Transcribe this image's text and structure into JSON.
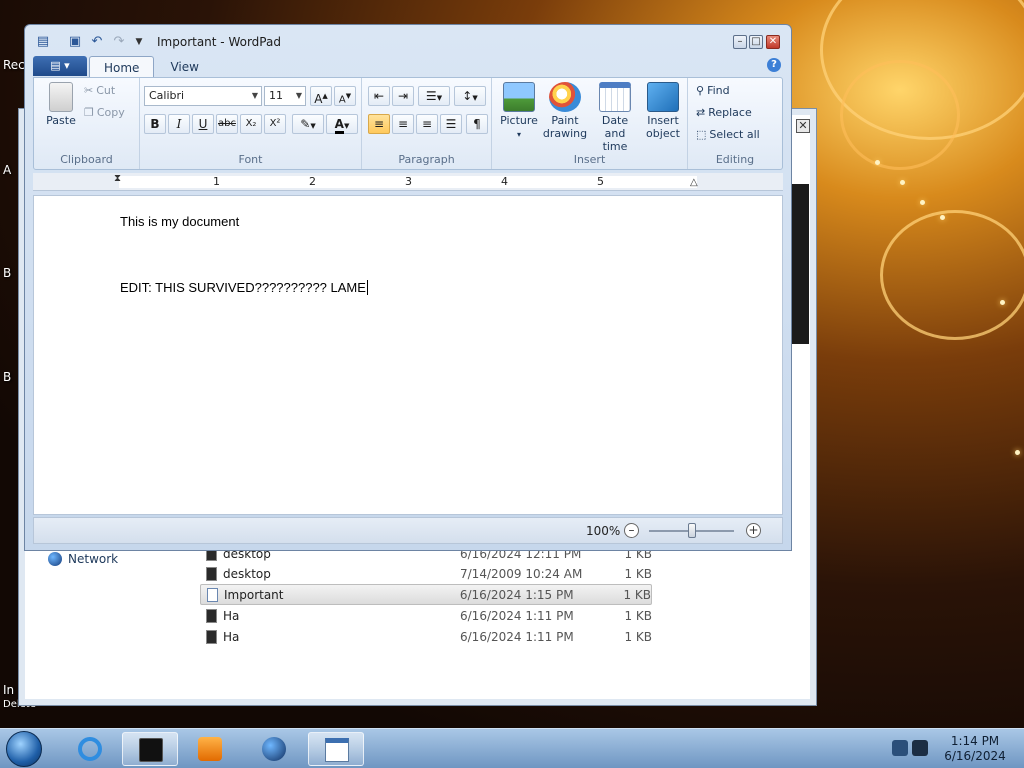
{
  "desktop": {
    "labels": [
      "Rec",
      "A",
      "B",
      "B",
      "In",
      "Delete"
    ]
  },
  "explorer": {
    "nav_network_label": "Network",
    "files": [
      {
        "name": "desktop",
        "date": "6/16/2024 12:11 PM",
        "size": "1 KB",
        "icon": "config-file-icon",
        "selected": false
      },
      {
        "name": "desktop",
        "date": "7/14/2009 10:24 AM",
        "size": "1 KB",
        "icon": "config-file-icon",
        "selected": false
      },
      {
        "name": "Important",
        "date": "6/16/2024 1:15 PM",
        "size": "1 KB",
        "icon": "document-icon",
        "selected": true
      },
      {
        "name": "Ha",
        "date": "6/16/2024 1:11 PM",
        "size": "1 KB",
        "icon": "config-file-icon",
        "selected": false
      },
      {
        "name": "Ha",
        "date": "6/16/2024 1:11 PM",
        "size": "1 KB",
        "icon": "config-file-icon",
        "selected": false
      }
    ]
  },
  "wordpad": {
    "title": "Important - WordPad",
    "tabs": [
      "Home",
      "View"
    ],
    "active_tab": "Home",
    "clipboard": {
      "paste_label": "Paste",
      "cut_label": "Cut",
      "copy_label": "Copy",
      "group_label": "Clipboard"
    },
    "font": {
      "family": "Calibri",
      "size": "11",
      "group_label": "Font",
      "bold": "B",
      "italic": "I",
      "underline": "U",
      "strike": "abc",
      "subscript": "X₂",
      "superscript": "X²"
    },
    "paragraph": {
      "group_label": "Paragraph"
    },
    "insert": {
      "picture_label": "Picture",
      "paint_label_1": "Paint",
      "paint_label_2": "drawing",
      "datetime_label_1": "Date and",
      "datetime_label_2": "time",
      "object_label_1": "Insert",
      "object_label_2": "object",
      "group_label": "Insert"
    },
    "editing": {
      "find_label": "Find",
      "replace_label": "Replace",
      "select_all_label": "Select all",
      "group_label": "Editing"
    },
    "ruler_numbers": [
      "1",
      "2",
      "3",
      "4",
      "5"
    ],
    "document": {
      "line1": "This is my document",
      "line2": "EDIT: THIS SURVIVED?????????? LAME"
    },
    "status": {
      "zoom": "100%",
      "zoom_fraction": 0.5
    }
  },
  "taskbar": {
    "clock_time": "1:14 PM",
    "clock_date": "6/16/2024",
    "items": [
      "internet-explorer-icon",
      "terminal-icon",
      "media-player-icon",
      "network-globe-icon",
      "wordpad-icon"
    ]
  },
  "colors": {
    "accent": "#1f4a8a",
    "selection": "#ffc95c",
    "taskbar": "#6f96c2"
  }
}
